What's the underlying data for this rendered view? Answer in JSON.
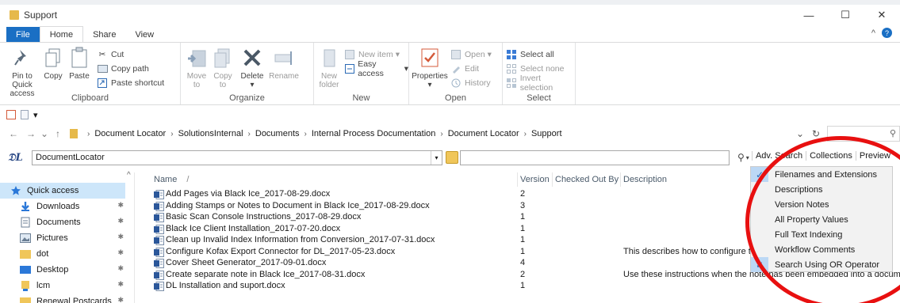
{
  "window": {
    "title": "Support",
    "minimize": "—",
    "maximize": "☐",
    "close": "✕"
  },
  "tabs": [
    {
      "label": "File",
      "kind": "file"
    },
    {
      "label": "Home",
      "kind": "active"
    },
    {
      "label": "Share",
      "kind": "normal"
    },
    {
      "label": "View",
      "kind": "normal"
    }
  ],
  "ribbon_caret": "^",
  "help": "?",
  "ribbon": {
    "clipboard": {
      "label": "Clipboard",
      "pin": "Pin to Quick access",
      "copy": "Copy",
      "paste": "Paste",
      "cut": "Cut",
      "copy_path": "Copy path",
      "paste_shortcut": "Paste shortcut"
    },
    "organize": {
      "label": "Organize",
      "move_to": "Move to",
      "copy_to": "Copy to",
      "delete": "Delete",
      "rename": "Rename",
      "caret": "▾"
    },
    "new": {
      "label": "New",
      "new_folder": "New folder",
      "new_item": "New item",
      "easy_access": "Easy access",
      "caret": "▾"
    },
    "open": {
      "label": "Open",
      "properties": "Properties",
      "open": "Open",
      "edit": "Edit",
      "history": "History",
      "caret": "▾"
    },
    "select": {
      "label": "Select",
      "select_all": "Select all",
      "select_none": "Select none",
      "invert": "Invert selection"
    }
  },
  "qat": {
    "dropdown": "▾"
  },
  "address": {
    "back": "←",
    "forward": "→",
    "recent": "⌄",
    "up": "↑",
    "breadcrumb": [
      "Document Locator",
      "SolutionsInternal",
      "Documents",
      "Internal Process Documentation",
      "Document Locator",
      "Support"
    ],
    "sep": "›",
    "dropdown": "⌄",
    "refresh": "↻",
    "search_icon": "⚲"
  },
  "dl_bar": {
    "logo": "𝔇L",
    "location": "DocumentLocator",
    "dropdown": "▾",
    "search_icon": "⚲",
    "caret": "▾",
    "links": [
      "Adv. Search",
      "Collections",
      "Preview"
    ]
  },
  "sidebar": {
    "items": [
      {
        "label": "Quick access",
        "icon": "star-icon",
        "pinned": false
      },
      {
        "label": "Downloads",
        "icon": "download-icon",
        "pinned": true
      },
      {
        "label": "Documents",
        "icon": "documents-icon",
        "pinned": true
      },
      {
        "label": "Pictures",
        "icon": "pictures-icon",
        "pinned": true
      },
      {
        "label": "dot",
        "icon": "folder-icon",
        "pinned": true
      },
      {
        "label": "Desktop",
        "icon": "desktop-icon",
        "pinned": true
      },
      {
        "label": "lcm",
        "icon": "folder-icon",
        "pinned": true
      },
      {
        "label": "Renewal Postcards",
        "icon": "folder-icon",
        "pinned": true
      }
    ],
    "pin_glyph": "✱",
    "scroll_up": "^"
  },
  "columns": {
    "name": "Name",
    "sort_glyph": "/",
    "version": "Version",
    "checked_out_by": "Checked Out By",
    "description": "Description"
  },
  "files": [
    {
      "name": "Add Pages via Black Ice_2017-08-29.docx",
      "version": "2",
      "description": ""
    },
    {
      "name": "Adding Stamps or Notes to Document in Black Ice_2017-08-29.docx",
      "version": "3",
      "description": ""
    },
    {
      "name": "Basic Scan Console Instructions_2017-08-29.docx",
      "version": "1",
      "description": ""
    },
    {
      "name": "Black Ice Client Installation_2017-07-20.docx",
      "version": "1",
      "description": ""
    },
    {
      "name": "Clean up Invalid Index Information from Conversion_2017-07-31.docx",
      "version": "1",
      "description": ""
    },
    {
      "name": "Configure Kofax Export Connector for DL_2017-05-23.docx",
      "version": "1",
      "description": "This describes how to configure the"
    },
    {
      "name": "Cover Sheet Generator_2017-09-01.docx",
      "version": "4",
      "description": ""
    },
    {
      "name": "Create separate note in Black Ice_2017-08-31.docx",
      "version": "2",
      "description": "Use these instructions when the note has been embedded into a docume"
    },
    {
      "name": "DL Installation and suport.docx",
      "version": "1",
      "description": ""
    }
  ],
  "search_menu": {
    "items": [
      {
        "label": "Filenames and Extensions",
        "checked": true
      },
      {
        "label": "Descriptions",
        "checked": false
      },
      {
        "label": "Version Notes",
        "checked": false
      },
      {
        "label": "All Property Values",
        "checked": false
      },
      {
        "label": "Full Text Indexing",
        "checked": false
      },
      {
        "label": "Workflow Comments",
        "checked": false
      },
      {
        "label": "Search Using OR Operator",
        "checked": true
      }
    ],
    "check_glyph": "✓"
  },
  "colors": {
    "accent": "#1a6fc4",
    "highlight": "#cde6fa",
    "annotation": "#e81010",
    "folder": "#e6b94a"
  }
}
